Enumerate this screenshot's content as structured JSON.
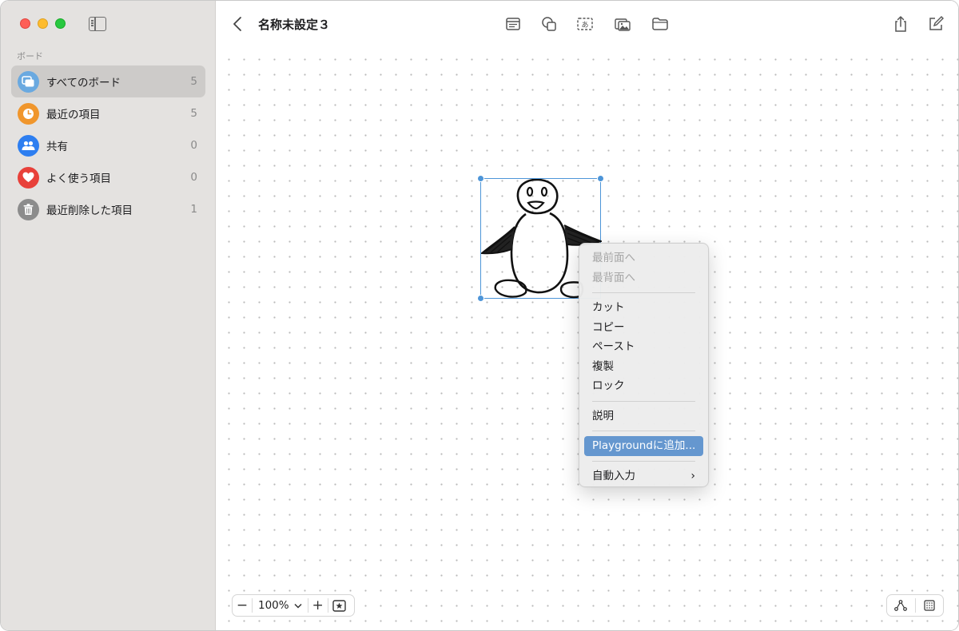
{
  "sidebar": {
    "section_label": "ボード",
    "items": [
      {
        "label": "すべてのボード",
        "count": "5",
        "icon": "boards-icon",
        "color": "#6aa9e0",
        "active": true
      },
      {
        "label": "最近の項目",
        "count": "5",
        "icon": "clock-icon",
        "color": "#f0962c"
      },
      {
        "label": "共有",
        "count": "0",
        "icon": "people-icon",
        "color": "#2d7ef0"
      },
      {
        "label": "よく使う項目",
        "count": "0",
        "icon": "heart-icon",
        "color": "#e8413a"
      },
      {
        "label": "最近削除した項目",
        "count": "1",
        "icon": "trash-icon",
        "color": "#8c8c8c"
      }
    ]
  },
  "header": {
    "title": "名称未設定３",
    "tools": [
      "note-icon",
      "shapes-icon",
      "textbox-icon",
      "media-icon",
      "folder-icon",
      "share-icon",
      "compose-icon"
    ]
  },
  "zoom": {
    "minus": "−",
    "value": "100%",
    "plus": "+",
    "chevron": "⌄"
  },
  "context_menu": {
    "items": [
      {
        "label": "最前面へ",
        "disabled": true
      },
      {
        "label": "最背面へ",
        "disabled": true
      },
      {
        "label": "カット"
      },
      {
        "label": "コピー"
      },
      {
        "label": "ペースト"
      },
      {
        "label": "複製"
      },
      {
        "label": "ロック"
      },
      {
        "label": "説明"
      },
      {
        "label": "Playgroundに追加...",
        "highlighted": true
      },
      {
        "label": "自動入力",
        "submenu": true
      }
    ]
  },
  "colors": {
    "selection": "#4d95d8",
    "highlight": "#6597cf"
  }
}
